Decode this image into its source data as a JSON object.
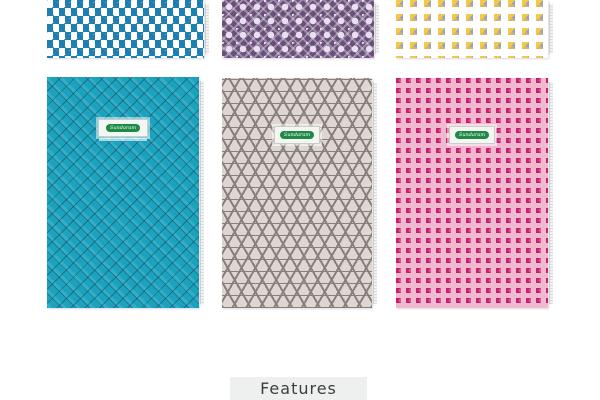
{
  "products": {
    "top_row": [
      {
        "pattern": "blue-diamond",
        "color": "#1f7fb0"
      },
      {
        "pattern": "purple-damask",
        "color": "#6a4f7a"
      },
      {
        "pattern": "pastel-chevron",
        "color": "#f2c94c"
      }
    ],
    "main_row": [
      {
        "pattern": "teal-lattice",
        "color": "#1aa2bf",
        "brand_label": "Sundaram"
      },
      {
        "pattern": "grey-geometric",
        "color": "#8a7f7a",
        "brand_label": "Sundaram"
      },
      {
        "pattern": "pink-zigzag",
        "color": "#c2246b",
        "brand_label": "Sundaram"
      }
    ]
  },
  "features": {
    "label": "Features"
  }
}
